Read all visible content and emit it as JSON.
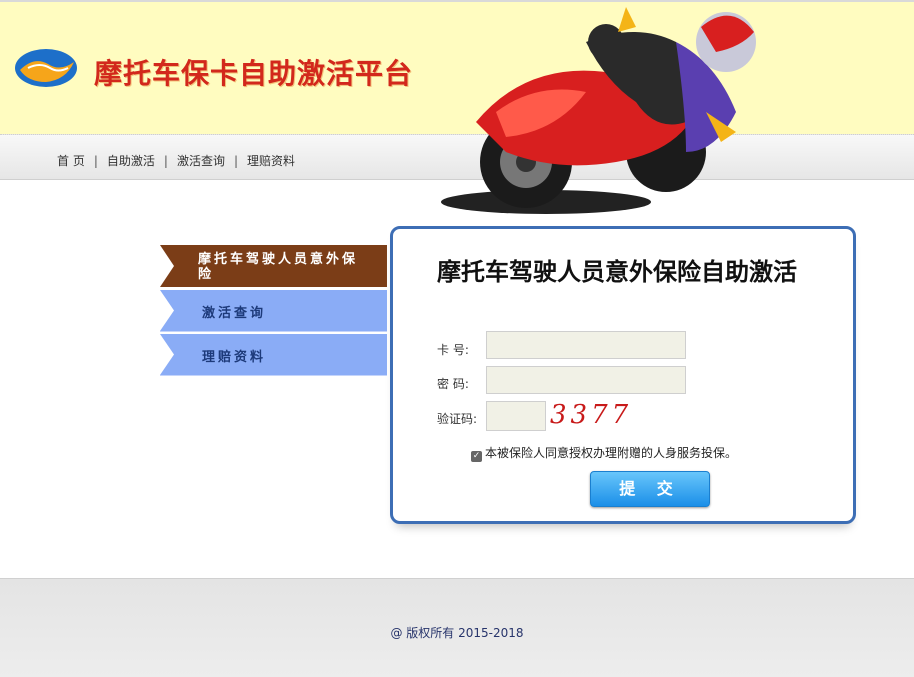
{
  "header": {
    "site_title": "摩托车保卡自助激活平台",
    "logo_icon": "handshake-logo-icon",
    "banner_image": "motorcycle-racer-illustration"
  },
  "nav": {
    "items": [
      "首 页",
      "自助激活",
      "激活查询",
      "理赔资料"
    ],
    "separator": "|"
  },
  "sidebar": {
    "items": [
      {
        "label": "摩托车驾驶人员意外保险",
        "active": true
      },
      {
        "label": "激活查询",
        "active": false
      },
      {
        "label": "理赔资料",
        "active": false
      }
    ]
  },
  "form": {
    "title": "摩托车驾驶人员意外保险自助激活",
    "card_label": "卡 号:",
    "card_value": "",
    "password_label": "密 码:",
    "password_value": "",
    "captcha_label": "验证码:",
    "captcha_value": "",
    "captcha_text": "3377",
    "agree_text": "本被保险人同意授权办理附赠的人身服务投保。",
    "agree_checked": true,
    "submit_label": "提 交"
  },
  "footer": {
    "copyright": "@ 版权所有 2015-2018"
  },
  "colors": {
    "header_bg": "#fffcc0",
    "title_red": "#d2281c",
    "sidebar_active": "#7b3d17",
    "sidebar_inactive": "#8aacf6",
    "panel_border": "#3d6eb5",
    "button_blue": "#1b8fe8"
  }
}
